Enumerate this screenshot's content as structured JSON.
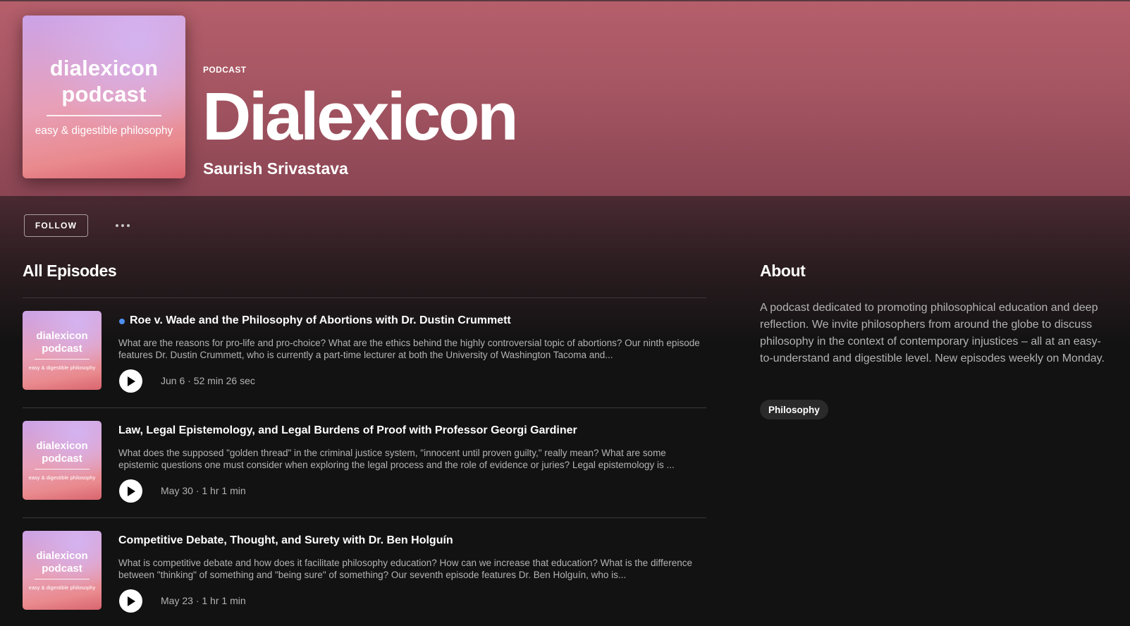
{
  "podcast": {
    "kind_label": "PODCAST",
    "title": "Dialexicon",
    "author": "Saurish Srivastava",
    "cover": {
      "title": "dialexicon podcast",
      "subtitle": "easy & digestible philosophy"
    }
  },
  "actions": {
    "follow_label": "FOLLOW",
    "more_icon": "ellipsis-icon"
  },
  "episodes_section": {
    "title": "All Episodes",
    "items": [
      {
        "thumb_title": "dialexicon podcast",
        "thumb_subtitle": "easy & digestible philosophy",
        "is_new": true,
        "title": "Roe v. Wade and the Philosophy of Abortions with Dr. Dustin Crummett",
        "description": "What are the reasons for pro-life and pro-choice? What are the ethics behind the highly controversial topic of abortions? Our ninth episode features Dr. Dustin Crummett, who is currently a part-time lecturer at both the University of Washington Tacoma and...",
        "date": "Jun 6",
        "separator": "·",
        "duration": "52 min 26 sec"
      },
      {
        "thumb_title": "dialexicon podcast",
        "thumb_subtitle": "easy & digestible philosophy",
        "is_new": false,
        "title": "Law, Legal Epistemology, and Legal Burdens of Proof with Professor Georgi Gardiner",
        "description": "What does the supposed \"golden thread\" in the criminal justice system, \"innocent until proven guilty,\" really mean? What are some epistemic questions one must consider when exploring the legal process and the role of evidence or juries?  Legal epistemology is ...",
        "date": "May 30",
        "separator": "·",
        "duration": "1 hr 1 min"
      },
      {
        "thumb_title": "dialexicon podcast",
        "thumb_subtitle": "easy & digestible philosophy",
        "is_new": false,
        "title": "Competitive Debate, Thought, and Surety with Dr. Ben Holguín",
        "description": "What is competitive debate and how does it facilitate philosophy education? How can we increase that education? What is the difference between \"thinking\" of something and \"being sure\" of something? Our seventh episode features Dr. Ben Holguín, who is...",
        "date": "May 23",
        "separator": "·",
        "duration": "1 hr 1 min"
      }
    ]
  },
  "about": {
    "title": "About",
    "text": "A podcast dedicated to promoting philosophical education and deep reflection. We invite philosophers from around the globe to discuss philosophy in the context of contemporary injustices – all at an easy-to-understand and digestible level. New episodes weekly on Monday.",
    "tags": [
      "Philosophy"
    ]
  },
  "colors": {
    "hero": "#b55f6b",
    "background": "#121212",
    "new_dot": "#4e8ff0"
  }
}
